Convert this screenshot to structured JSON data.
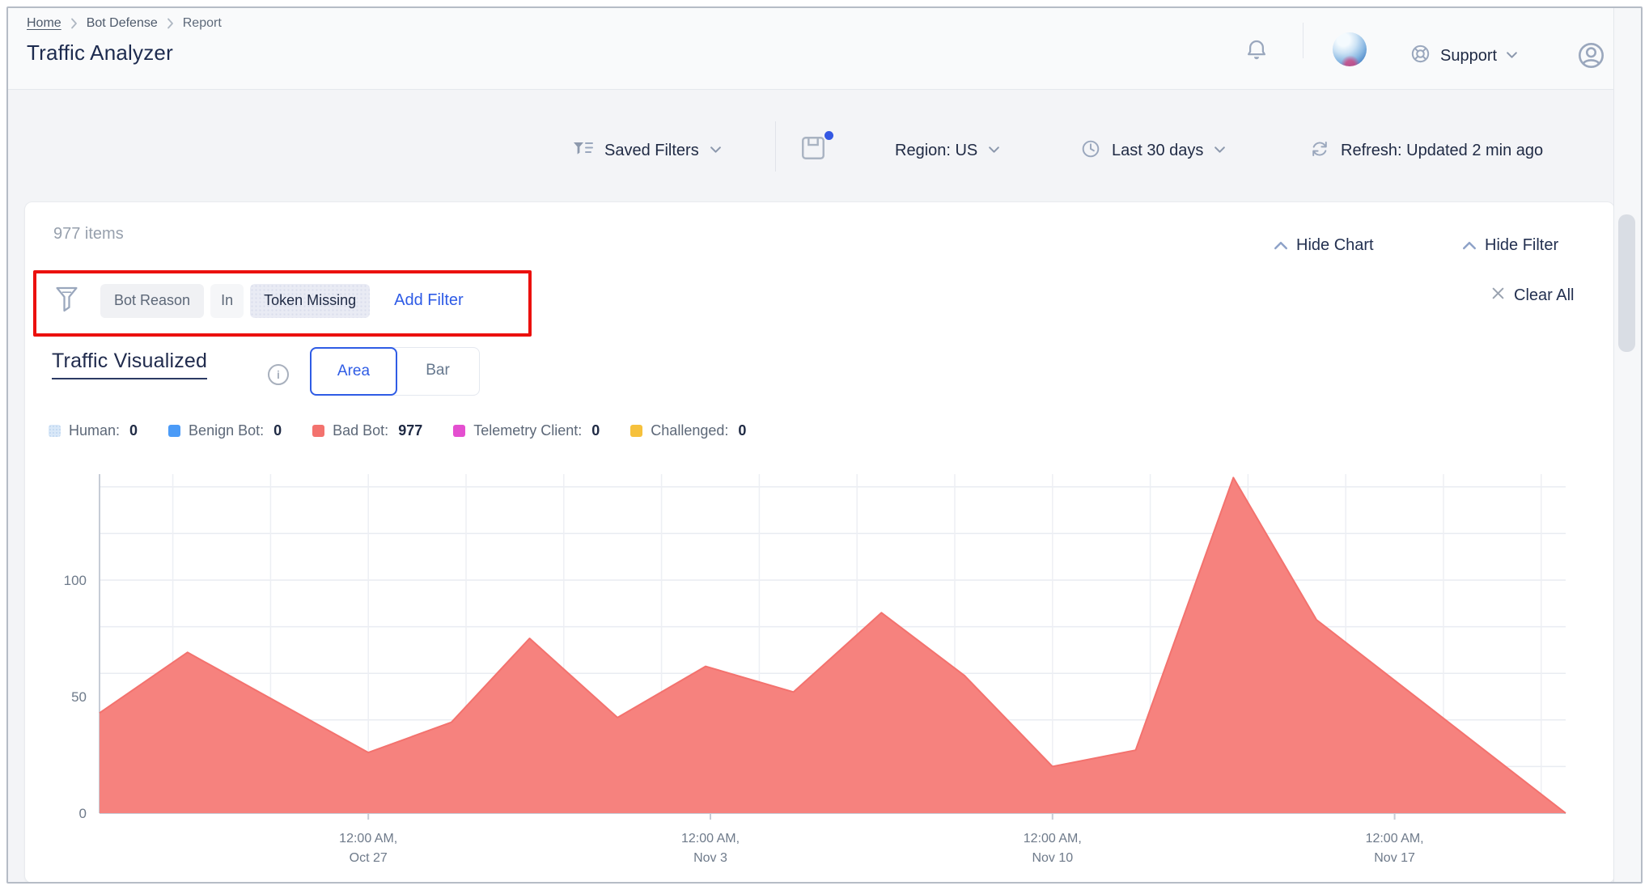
{
  "breadcrumb": {
    "items": [
      "Home",
      "Bot Defense",
      "Report"
    ]
  },
  "page": {
    "title": "Traffic Analyzer"
  },
  "header": {
    "support_label": "Support"
  },
  "toolbar": {
    "saved_filters": "Saved Filters",
    "region": "Region: US",
    "time_range": "Last 30 days",
    "refresh": "Refresh: Updated 2 min ago"
  },
  "results": {
    "items_count": "977 items",
    "hide_chart": "Hide Chart",
    "hide_filter": "Hide Filter"
  },
  "filter_bar": {
    "field": "Bot Reason",
    "operator": "In",
    "value": "Token Missing",
    "add_filter": "Add Filter",
    "clear_all": "Clear All"
  },
  "section": {
    "title": "Traffic Visualized",
    "area_label": "Area",
    "bar_label": "Bar",
    "selected_view": "Area"
  },
  "legend": [
    {
      "label": "Human:",
      "value": "0",
      "color": "#d9e8f8"
    },
    {
      "label": "Benign Bot:",
      "value": "0",
      "color": "#4b9bf7"
    },
    {
      "label": "Bad Bot:",
      "value": "977",
      "color": "#f3726e"
    },
    {
      "label": "Telemetry Client:",
      "value": "0",
      "color": "#e44fd0"
    },
    {
      "label": "Challenged:",
      "value": "0",
      "color": "#f6c13c"
    }
  ],
  "colors": {
    "accent_blue": "#2f5ce5",
    "annotation_red": "#eb100e",
    "area_fill": "#f6827e",
    "area_line": "#f3726e",
    "grid": "#e9ecf2",
    "axis": "#c6ccd6",
    "tick_text": "#6e7a8a"
  },
  "chart_data": {
    "type": "area",
    "title": "Traffic Visualized",
    "xlabel": "",
    "ylabel": "",
    "x_unit": "days from Oct 27, 12:00 AM",
    "x_range": [
      -5.5,
      24.5
    ],
    "y_max": 145.5,
    "y_grid_step": 20,
    "grid": true,
    "legend_position": "top-left",
    "y_ticks": [
      0,
      50,
      100
    ],
    "x_ticks": [
      {
        "pos": 0,
        "label_line1": "12:00 AM,",
        "label_line2": "Oct 27"
      },
      {
        "pos": 7,
        "label_line1": "12:00 AM,",
        "label_line2": "Nov 3"
      },
      {
        "pos": 14,
        "label_line1": "12:00 AM,",
        "label_line2": "Nov 10"
      },
      {
        "pos": 21,
        "label_line1": "12:00 AM,",
        "label_line2": "Nov 17"
      }
    ],
    "series": [
      {
        "name": "Bad Bot",
        "total": 977,
        "color": "#f6827e",
        "line_color": "#f3726e",
        "points": [
          [
            -5.5,
            43
          ],
          [
            -3.7,
            69
          ],
          [
            0,
            26
          ],
          [
            1.7,
            39
          ],
          [
            3.3,
            75
          ],
          [
            5.1,
            41
          ],
          [
            6.9,
            63
          ],
          [
            8.7,
            52
          ],
          [
            10.5,
            86
          ],
          [
            12.2,
            59
          ],
          [
            14,
            20
          ],
          [
            15.7,
            27
          ],
          [
            17.7,
            144
          ],
          [
            19.4,
            83
          ],
          [
            24.5,
            0
          ]
        ]
      }
    ]
  }
}
